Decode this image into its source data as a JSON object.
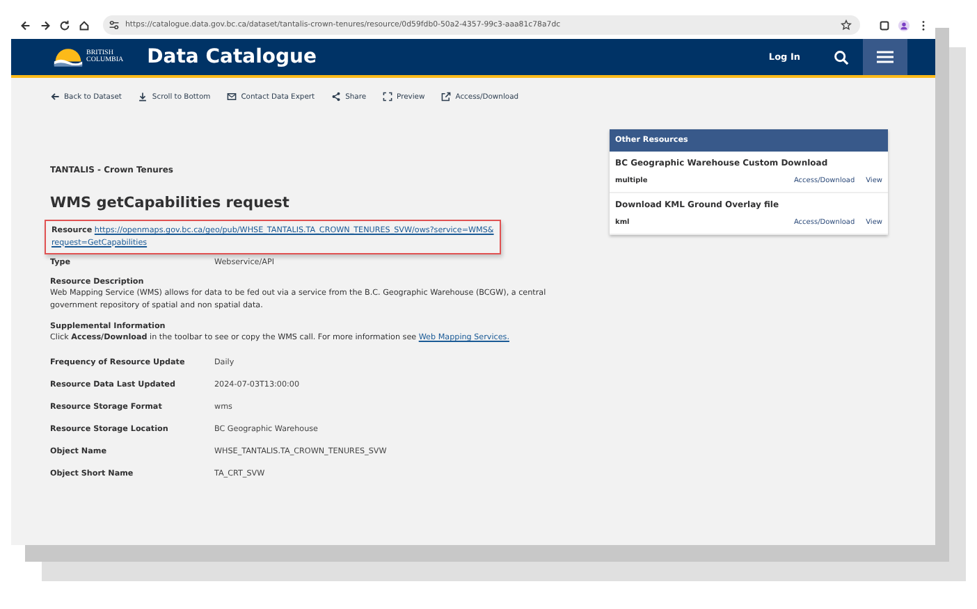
{
  "browser": {
    "url": "https://catalogue.data.gov.bc.ca/dataset/tantalis-crown-tenures/resource/0d59fdb0-50a2-4357-99c3-aaa81c78a7dc"
  },
  "header": {
    "logo_line1": "BRITISH",
    "logo_line2": "COLUMBIA",
    "title": "Data Catalogue",
    "login": "Log In"
  },
  "toolbar": [
    {
      "kind": "back",
      "label": "Back to Dataset"
    },
    {
      "kind": "download",
      "label": "Scroll to Bottom"
    },
    {
      "kind": "mail",
      "label": "Contact Data Expert"
    },
    {
      "kind": "share",
      "label": "Share"
    },
    {
      "kind": "expand",
      "label": "Preview"
    },
    {
      "kind": "external",
      "label": "Access/Download"
    }
  ],
  "breadcrumb": "TANTALIS - Crown Tenures",
  "heading": "WMS getCapabilities request",
  "resource": {
    "label": "Resource",
    "url": "https://openmaps.gov.bc.ca/geo/pub/WHSE_TANTALIS.TA_CROWN_TENURES_SVW/ows?service=WMS&request=GetCapabilities"
  },
  "type": {
    "label": "Type",
    "value": "Webservice/API"
  },
  "description": {
    "label": "Resource Description",
    "text": "Web Mapping Service (WMS) allows for data to be fed out via a service from the B.C. Geographic Warehouse (BCGW), a central government repository of spatial and non spatial data."
  },
  "supplemental": {
    "label": "Supplemental Information",
    "text": "Click **Access/Download** in the toolbar to see or copy the WMS call. For more information see",
    "link": "Web Mapping Services."
  },
  "fields": [
    {
      "label": "Frequency of Resource Update",
      "value": "Daily"
    },
    {
      "label": "Resource Data Last Updated",
      "value": "2024-07-03T13:00:00"
    },
    {
      "label": "Resource Storage Format",
      "value": "wms"
    },
    {
      "label": "Resource Storage Location",
      "value": "BC Geographic Warehouse"
    },
    {
      "label": "Object Name",
      "value": "WHSE_TANTALIS.TA_CROWN_TENURES_SVW"
    },
    {
      "label": "Object Short Name",
      "value": "TA_CRT_SVW"
    }
  ],
  "other_resources": {
    "title": "Other Resources",
    "items": [
      {
        "name": "BC Geographic Warehouse Custom Download",
        "format": "multiple",
        "access": "Access/Download",
        "view": "View"
      },
      {
        "name": "Download KML Ground Overlay file",
        "format": "kml",
        "access": "Access/Download",
        "view": "View"
      }
    ]
  }
}
